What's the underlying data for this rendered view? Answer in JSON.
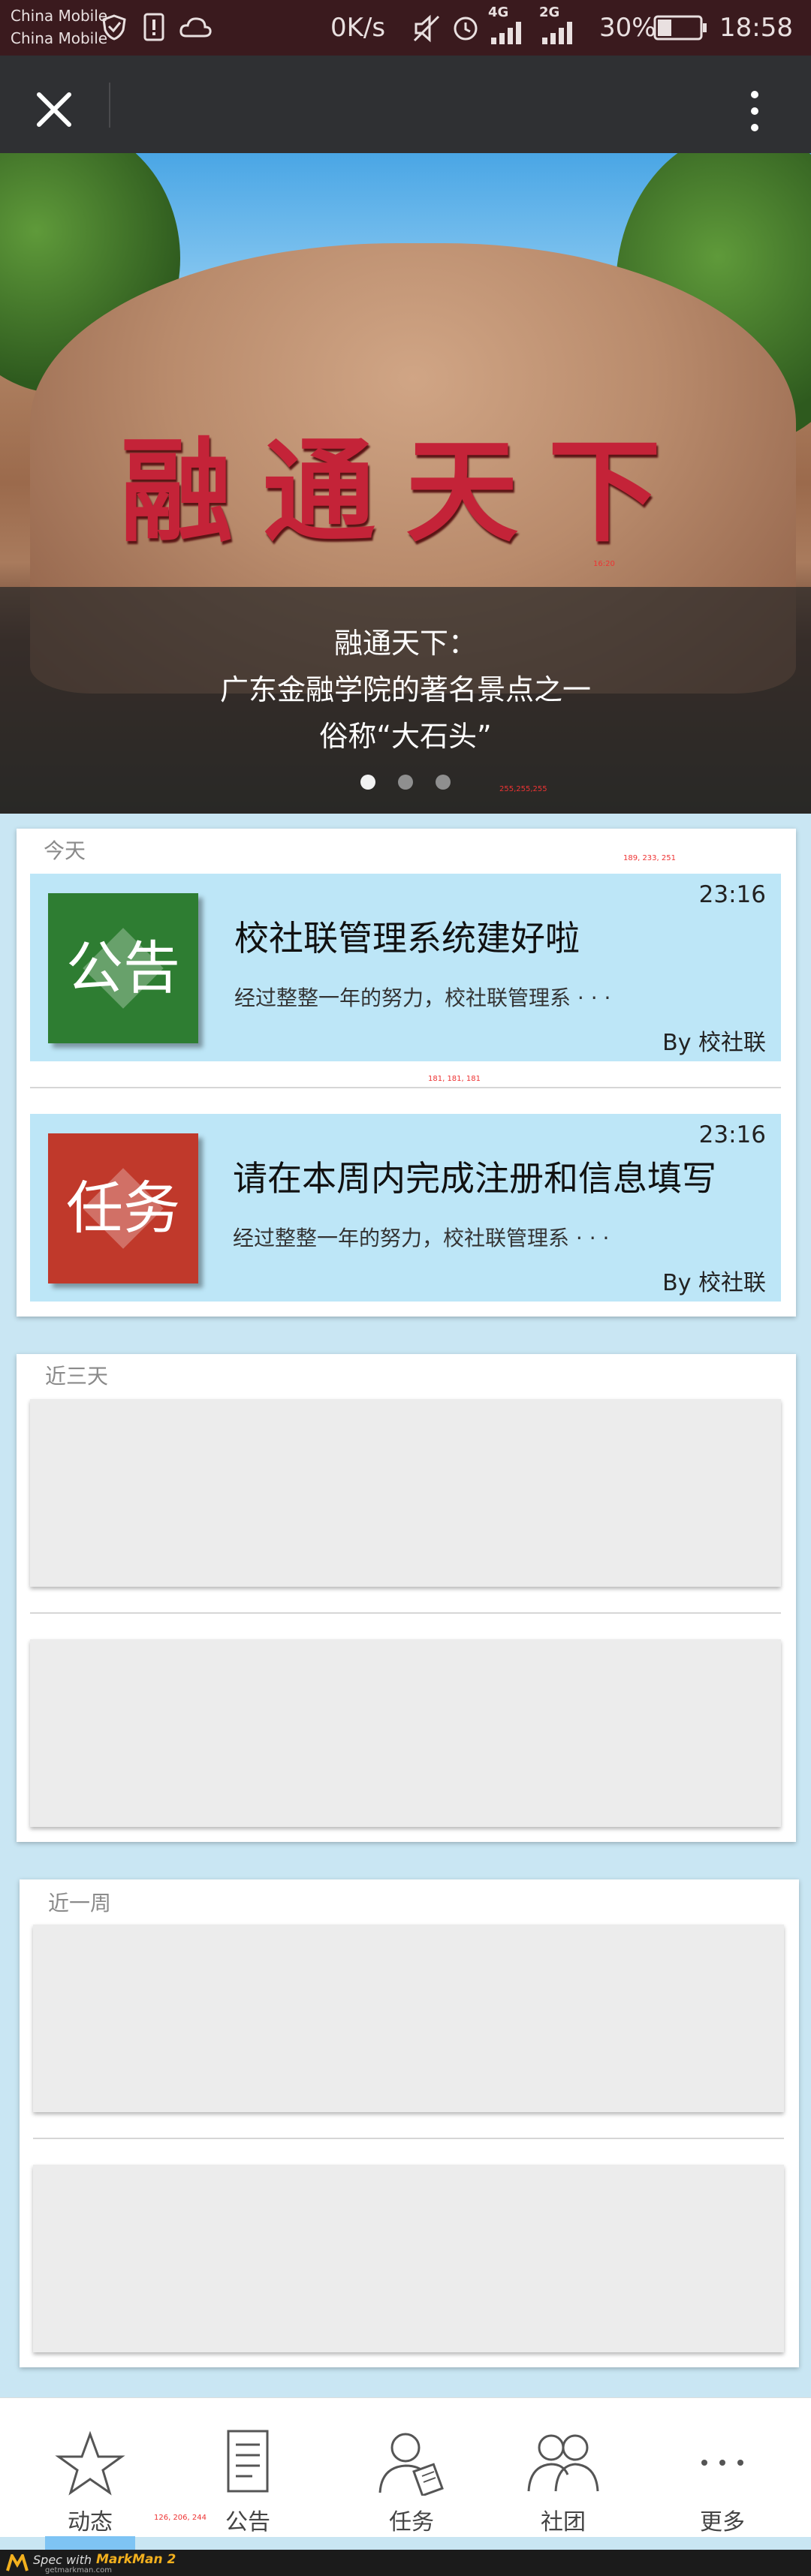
{
  "status_bar": {
    "carrier_1": "China Mobile",
    "carrier_2": "China Mobile",
    "net_speed": "0K/s",
    "network_1": "4G",
    "network_2": "2G",
    "battery": "30%",
    "time": "18:58"
  },
  "top_bar": {
    "close_icon": "close-icon",
    "more_icon": "more-vertical-icon"
  },
  "banner": {
    "carved_text": "融通天下",
    "caption_line_1": "融通天下：",
    "caption_line_2": "广东金融学院的著名景点之一",
    "caption_line_3": "俗称“大石头”",
    "dots": 3,
    "active_dot": 0,
    "annotation_1": "16:20",
    "annotation_2": "255,255,255"
  },
  "sections": {
    "today_label": "今天",
    "recent3_label": "近三天",
    "week_label": "近一周"
  },
  "messages": [
    {
      "icon_text": "公告",
      "icon_color": "#2e7d32",
      "title": "校社联管理系统建好啦",
      "time": "23:16",
      "snippet": "经过整整一年的努力，校社联管理系 · · ·",
      "author": "By 校社联"
    },
    {
      "icon_text": "任务",
      "icon_color": "#c0392b",
      "title": "请在本周内完成注册和信息填写",
      "time": "23:16",
      "snippet": "经过整整一年的努力，校社联管理系 · · ·",
      "author": "By 校社联"
    }
  ],
  "annotations": {
    "card_color": "189, 233, 251",
    "divider_color": "181, 181, 181",
    "nav_active_color": "126, 206, 244"
  },
  "bottom_nav": [
    {
      "label": "动态",
      "icon": "star-icon"
    },
    {
      "label": "公告",
      "icon": "document-icon"
    },
    {
      "label": "任务",
      "icon": "user-task-icon"
    },
    {
      "label": "社团",
      "icon": "group-icon"
    },
    {
      "label": "更多",
      "icon": "more-dots-icon"
    }
  ],
  "footer": {
    "spec_text": "Spec with",
    "brand": "MarkMan 2",
    "site": "getmarkman.com"
  },
  "colors": {
    "status_bar_bg": "#3a1a1e",
    "top_bar_bg": "#2f3033",
    "card_bg": "#bde6f7",
    "nav_accent": "#7ec4f4"
  }
}
